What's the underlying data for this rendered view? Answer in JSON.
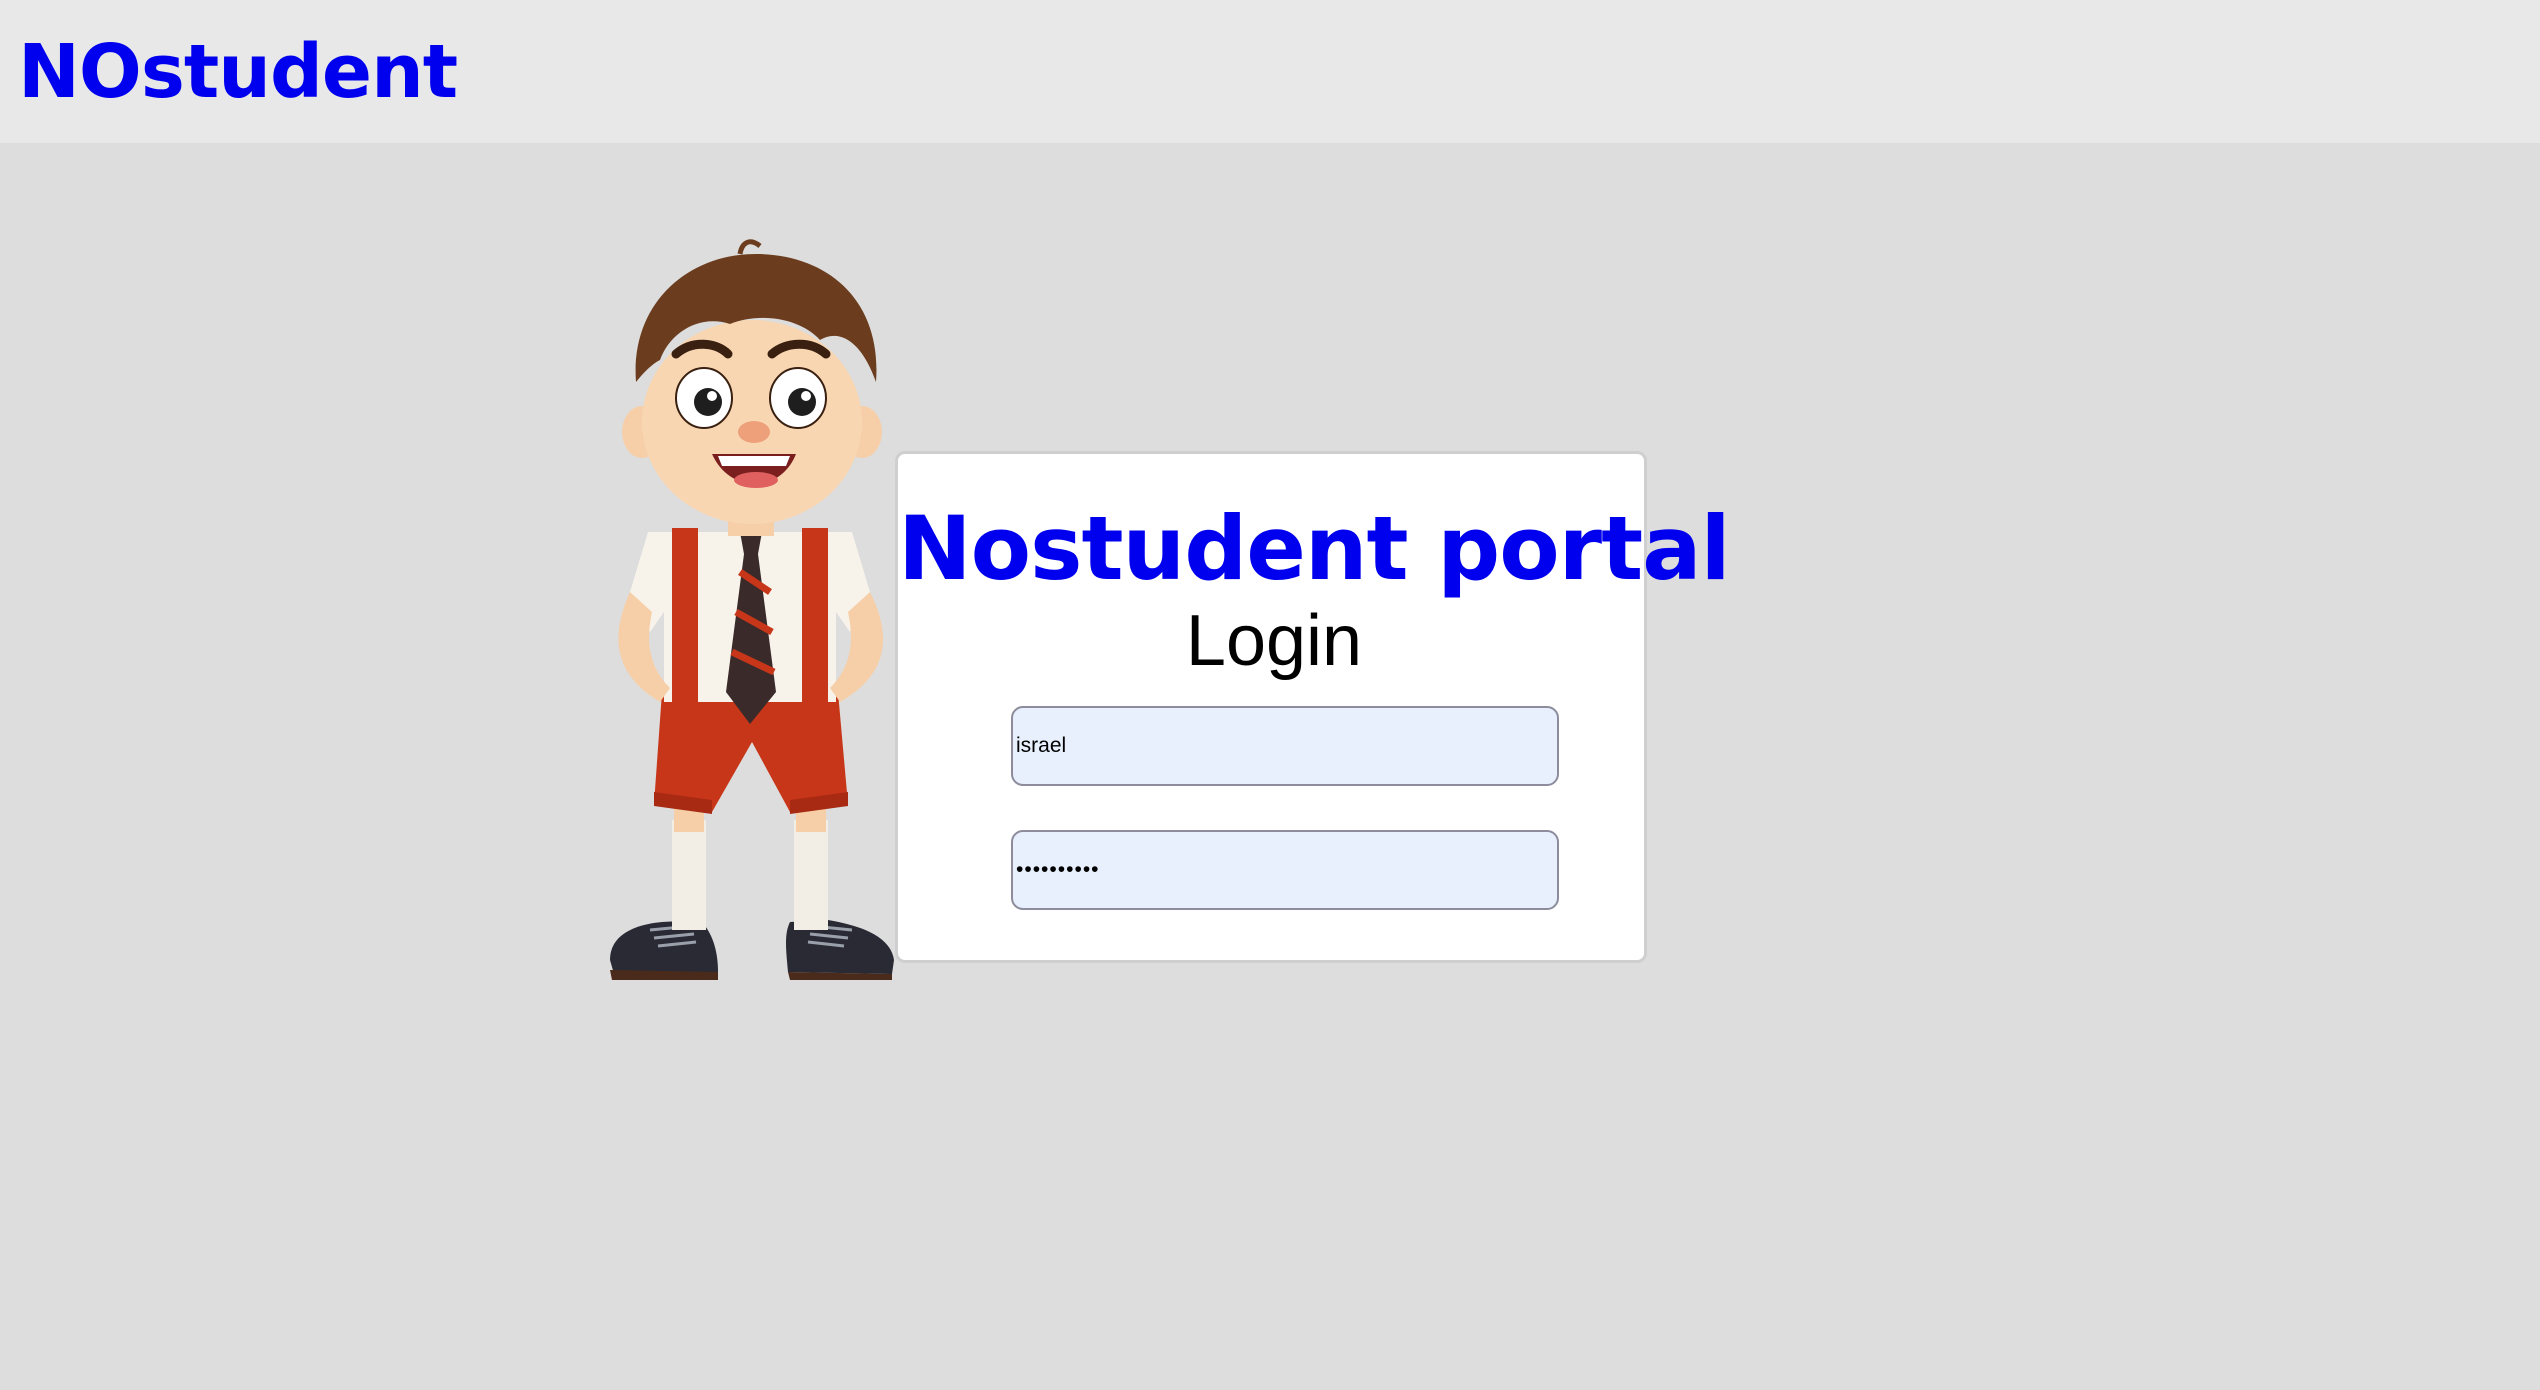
{
  "header": {
    "brand": "NOstudent",
    "background": "#e8e8e8",
    "brand_color": "#0000ee"
  },
  "mascot": {
    "icon": "student-mascot-illustration"
  },
  "login_card": {
    "title": "Nostudent portal",
    "heading": "Login",
    "username": {
      "value": "israel"
    },
    "password": {
      "value": "••••••••••"
    }
  },
  "colors": {
    "page_background": "#dddddd",
    "card_background": "#ffffff",
    "input_background": "#e8f0fe",
    "accent": "#0000ee"
  }
}
